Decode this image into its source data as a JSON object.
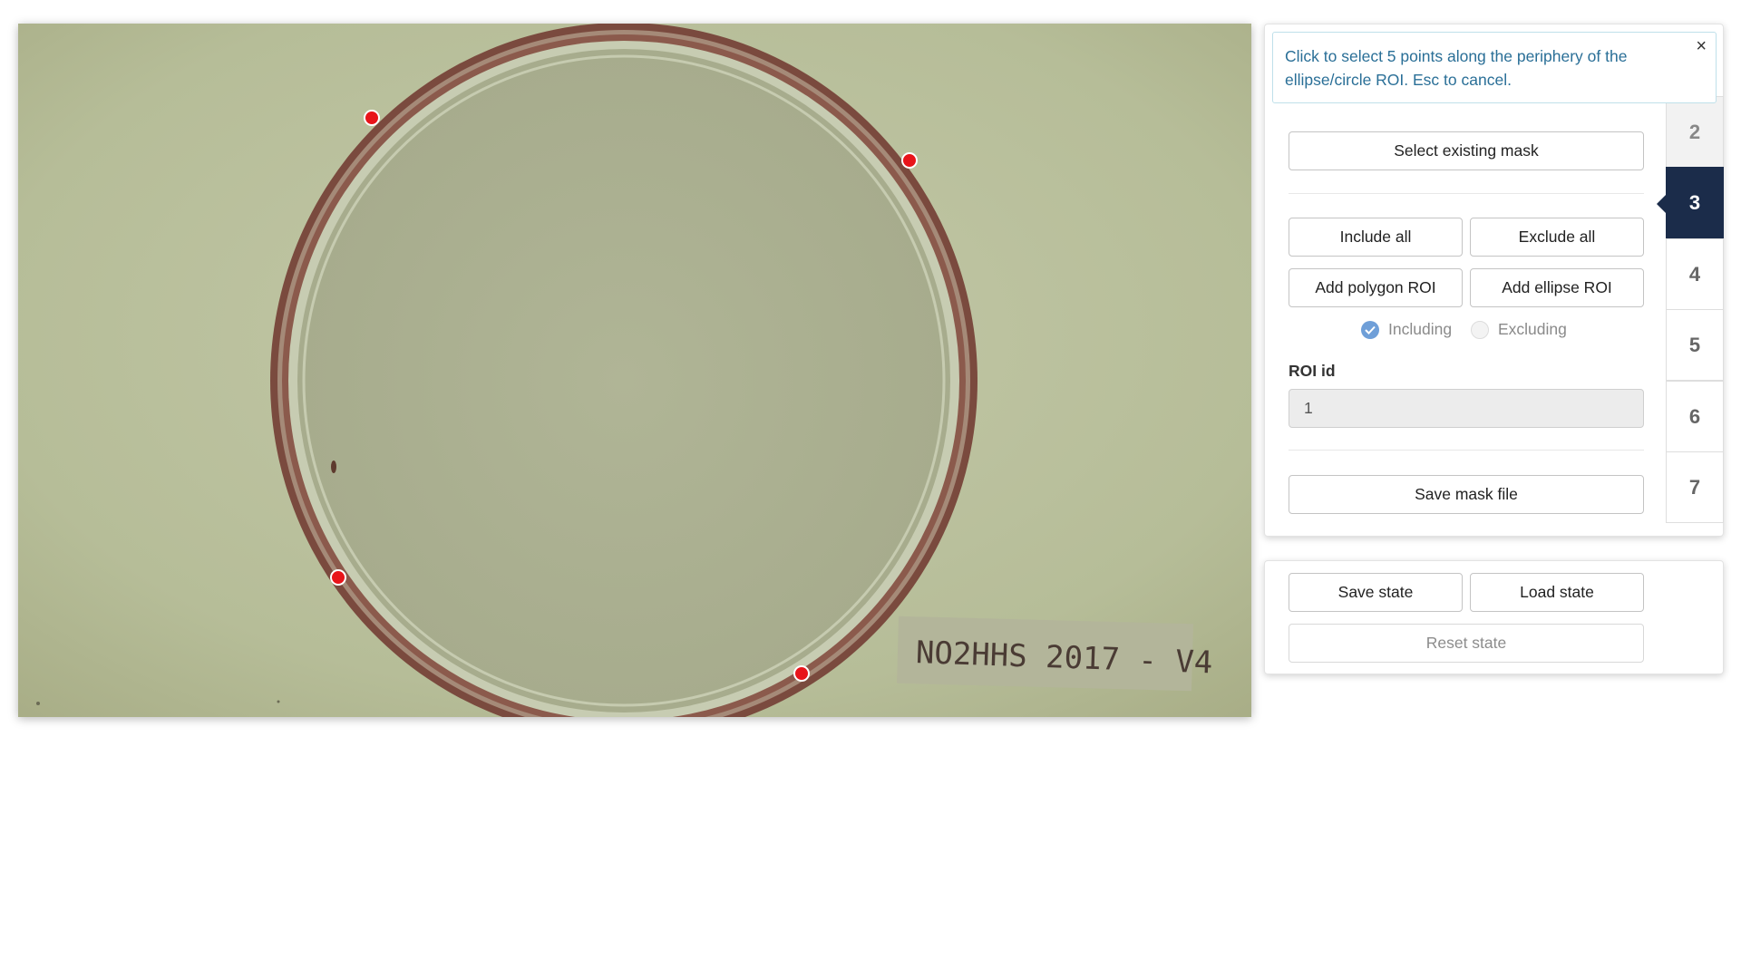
{
  "viewer": {
    "image_label": "NO2HHS 2017 - V4",
    "control_points": 4
  },
  "alert": {
    "message": "Click to select 5 points along the periphery of the ellipse/circle ROI. Esc to cancel.",
    "close_symbol": "×"
  },
  "steps": [
    "2",
    "3",
    "4",
    "5",
    "6",
    "7"
  ],
  "active_step": "3",
  "tools": {
    "select_existing_mask": "Select existing mask",
    "include_all": "Include all",
    "exclude_all": "Exclude all",
    "add_polygon_roi": "Add polygon ROI",
    "add_ellipse_roi": "Add ellipse ROI",
    "including": "Including",
    "excluding": "Excluding",
    "roi_id_label": "ROI id",
    "roi_id_value": "1",
    "save_mask_file": "Save mask file"
  },
  "state": {
    "save_state": "Save state",
    "load_state": "Load state",
    "reset_state": "Reset state"
  },
  "colors": {
    "accent": "#1b2c4a",
    "alert_text": "#2a6f97",
    "control_point": "#e8141a",
    "radio_checked": "#6f9fd8"
  }
}
